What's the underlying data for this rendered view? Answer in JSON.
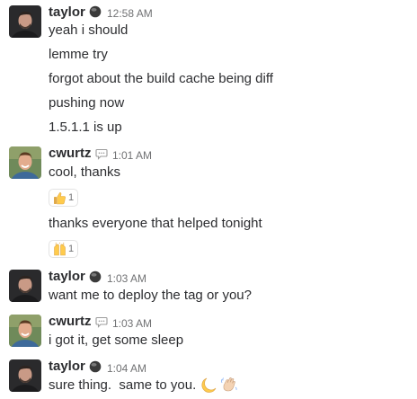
{
  "messages": [
    {
      "user": "taylor",
      "status_icon": "away-dot-icon",
      "time": "12:58 AM",
      "lines": [
        "yeah i should",
        "lemme try",
        "forgot about the build cache being diff",
        "pushing now",
        "1.5.1.1 is up"
      ]
    },
    {
      "user": "cwurtz",
      "status_icon": "speech-bubble-icon",
      "time": "1:01 AM",
      "lines": [
        "cool, thanks",
        "thanks everyone that helped tonight"
      ],
      "reactions": [
        {
          "emoji": "thumbs-up",
          "count": "1"
        },
        {
          "emoji": "raised-hands",
          "count": "1"
        }
      ]
    },
    {
      "user": "taylor",
      "status_icon": "away-dot-icon",
      "time": "1:03 AM",
      "lines": [
        "want me to deploy the tag or you?"
      ]
    },
    {
      "user": "cwurtz",
      "status_icon": "speech-bubble-icon",
      "time": "1:03 AM",
      "lines": [
        "i got it, get some sleep"
      ]
    },
    {
      "user": "taylor",
      "status_icon": "away-dot-icon",
      "time": "1:04 AM",
      "lines": [
        "sure thing.  same to you."
      ],
      "inline_emoji": [
        "crescent-moon",
        "waving-hand"
      ]
    }
  ]
}
